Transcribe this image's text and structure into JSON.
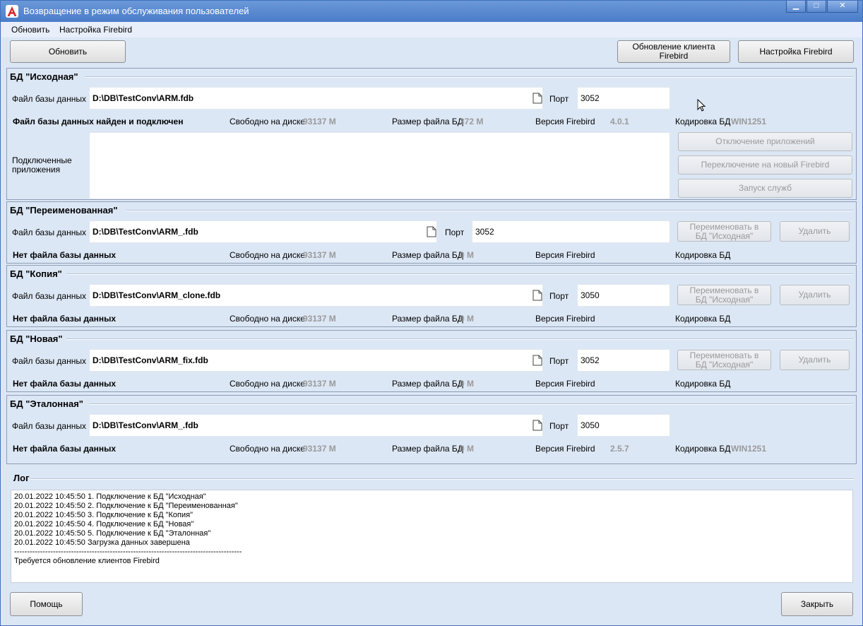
{
  "window": {
    "title": "Возвращение в режим обслуживания пользователей"
  },
  "menu": {
    "refresh": "Обновить",
    "firebird_settings": "Настройка Firebird"
  },
  "toolbar": {
    "refresh_button": "Обновить",
    "update_client_button_l1": "Обновление клиента",
    "update_client_button_l2": "Firebird",
    "firebird_settings_button": "Настройка Firebird"
  },
  "common": {
    "file_label": "Файл базы данных",
    "port_label": "Порт",
    "free_disk_label": "Свободно на диске",
    "size_label": "Размер файла   БД",
    "version_label": "Версия Firebird",
    "encoding_label": "Кодировка БД",
    "rename_button_l1": "Переименовать в",
    "rename_button_l2": "БД \"Исходная\"",
    "delete_button": "Удалить"
  },
  "source": {
    "title": "БД \"Исходная\"",
    "file": "D:\\DB\\TestConv\\ARM.fdb",
    "port": "3052",
    "status": "Файл базы данных найден и подключен",
    "free": "93137 М",
    "size": "372 М",
    "version": "4.0.1",
    "encoding": "WIN1251",
    "connected_label_l1": "Подключенные",
    "connected_label_l2": "приложения",
    "btn_disconnect": "Отключение приложений",
    "btn_switch": "Переключение на новый Firebird",
    "btn_services": "Запуск служб"
  },
  "renamed": {
    "title": "БД \"Переименованная\"",
    "file": "D:\\DB\\TestConv\\ARM_.fdb",
    "port": "3052",
    "status": "Нет файла базы данных",
    "free": "93137 М",
    "size": "0 М",
    "version": "",
    "encoding": ""
  },
  "copy": {
    "title": "БД \"Копия\"",
    "file": "D:\\DB\\TestConv\\ARM_clone.fdb",
    "port": "3050",
    "status": "Нет файла базы данных",
    "free": "93137 М",
    "size": "0 М",
    "version": "",
    "encoding": ""
  },
  "new": {
    "title": "БД \"Новая\"",
    "file": "D:\\DB\\TestConv\\ARM_fix.fdb",
    "port": "3052",
    "status": "Нет файла базы данных",
    "free": "93137 М",
    "size": "0 М",
    "version": "",
    "encoding": ""
  },
  "reference": {
    "title": "БД \"Эталонная\"",
    "file": "D:\\DB\\TestConv\\ARM_.fdb",
    "port": "3050",
    "status": "Нет файла базы данных",
    "free": "93137 М",
    "size": "0 М",
    "version": "2.5.7",
    "encoding": "WIN1251"
  },
  "log": {
    "title": "Лог",
    "text": "20.01.2022 10:45:50 1. Подключение к БД \"Исходная\"\n20.01.2022 10:45:50 2. Подключение к БД \"Переименованная\"\n20.01.2022 10:45:50 3. Подключение к БД \"Копия\"\n20.01.2022 10:45:50 4. Подключение к БД \"Новая\"\n20.01.2022 10:45:50 5. Подключение к БД \"Эталонная\"\n20.01.2022 10:45:50 Загрузка данных завершена\n----------------------------------------------------------------------------------------\nТребуется обновление клиентов Firebird"
  },
  "footer": {
    "help_button": "Помощь",
    "close_button": "Закрыть"
  }
}
